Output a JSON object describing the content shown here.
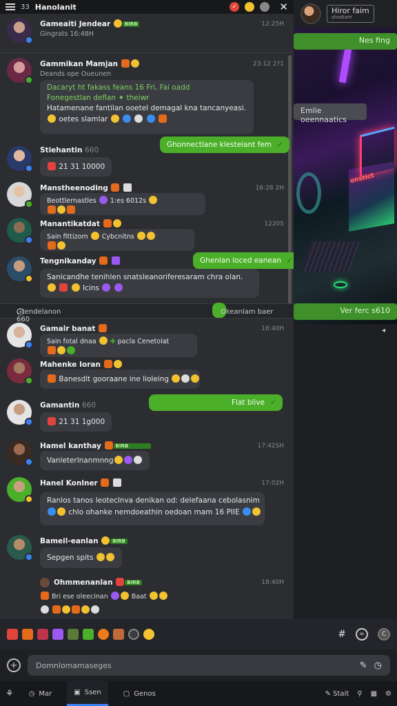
{
  "topbar": {
    "tag": "33",
    "title": "Hanolanit"
  },
  "video_panel": {
    "name": "Hiror faim",
    "sub": "shodiam",
    "neon_text": "onstict",
    "bubble_top": "Nes fing",
    "bubble_mid": "Emlie oeennaatics",
    "bubble_bottom": "Ver ferc s610"
  },
  "messages": [
    {
      "name": "Gameaiti Jendear",
      "time": "12:25H",
      "sub": "Gingrats 16:48H"
    },
    {
      "name": "Gammikan Mamjan",
      "time": "23:12 2?1",
      "sub": "Deands ope Oueunen",
      "lines": [
        "Dacaryt ht fakass feans 16 Fri, Fai oadd",
        "Fonegestlan deflan ✦ theiwr",
        "Hatamenane fantilan ooetel demagal kna tancanyeasi.",
        "oetes slamlar"
      ]
    },
    {
      "name": "Stiehantin",
      "tag": "660",
      "inline": "21 31 10000",
      "green": "Ghonnectlane klesteiant fem"
    },
    {
      "name": "Manstheenoding",
      "time": "16:28 2H",
      "sub": "Beottlernastles",
      "sub2": "1:es  6012s"
    },
    {
      "name": "Manantikatdat",
      "time": "1220S",
      "sub": "Sain fittizom",
      "sub2": "Cybcnitns"
    },
    {
      "name": "Tengnikanday",
      "green": "Ghenlan loced eanean",
      "lines": [
        "Sanicandhe tenihlen snatsleanoriferesaram chra olan.",
        "Icins"
      ]
    },
    {
      "divider": "Gtendelanon 660",
      "green": "Okeanlam baer"
    },
    {
      "name": "Gamalr banat",
      "time": "18:40H",
      "sub": "Sain fotal dnaa",
      "sub2": "pacla  Cenetolat"
    },
    {
      "name": "Mahenke Ioran",
      "sub": "Banesdlt gooraane ine lioleing"
    },
    {
      "name": "Gamantin",
      "tag": "660",
      "inline": "21 31 1g000",
      "green": "Flat blive"
    },
    {
      "name": "Hamel kanthay",
      "time": "17:42SH",
      "sub": "Vanleterlnanmnng"
    },
    {
      "name": "Hanel Konlner",
      "time": "17:02H",
      "lines": [
        "Ranlos tanos leoteclnva denikan od: delefaana cebolasnim",
        "chlo ohanke nemdoeathin oedoan mam 16 PIIE"
      ]
    },
    {
      "name": "Bameil-eanlan",
      "sub": "Sepgen spits"
    },
    {
      "name": "Ohmmenanlan",
      "time": "18:40H",
      "sub": "Bri ese oleecinan",
      "sub2": "Baat"
    }
  ],
  "input": {
    "placeholder": "Domnlomamaseges"
  },
  "bottomnav": {
    "tab1": "Mar",
    "tab2": "Ssen",
    "tab3": "Genos",
    "right1": "Stait"
  }
}
